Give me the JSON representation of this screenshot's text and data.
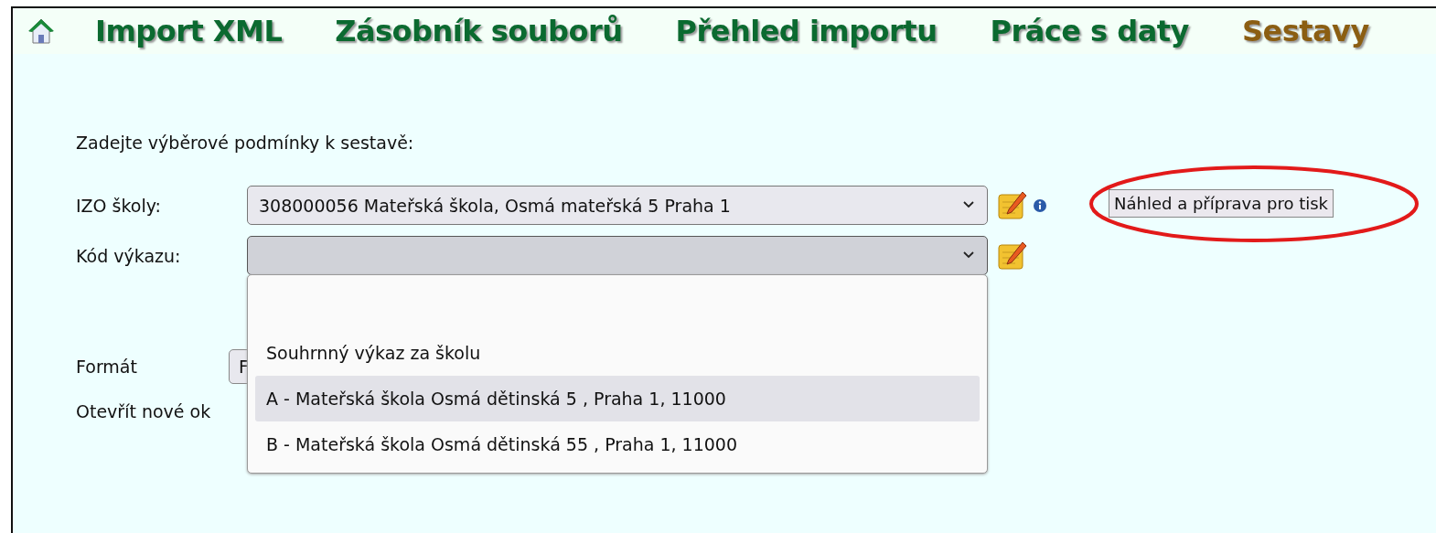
{
  "nav": {
    "items": [
      {
        "label": "Import XML",
        "selected": false
      },
      {
        "label": "Zásobník souborů",
        "selected": false
      },
      {
        "label": "Přehled importu",
        "selected": false
      },
      {
        "label": "Práce s daty",
        "selected": false
      },
      {
        "label": "Sestavy",
        "selected": true
      }
    ]
  },
  "form": {
    "title": "Zadejte výběrové podmínky k sestavě:",
    "fields": [
      {
        "label": "IZO školy:",
        "value": "308000056 Mateřská škola, Osmá mateřská 5 Praha 1",
        "open": false,
        "info": true
      },
      {
        "label": "Kód výkazu:",
        "open": true,
        "info": false,
        "options": [
          {
            "label": "Souhrnný výkaz za školu",
            "selected": false
          },
          {
            "label": "A - Mateřská škola Osmá dětinská 5 , Praha 1, 11000",
            "selected": true
          },
          {
            "label": "B - Mateřská škola Osmá dětinská 55 , Praha 1, 11000",
            "selected": false
          }
        ]
      }
    ],
    "format": {
      "label": "Formát",
      "value": "F"
    },
    "open_window": {
      "label": "Otevřít nové ok"
    }
  },
  "preview_button": {
    "label": "Náhled a příprava pro tisk",
    "circled": true
  }
}
